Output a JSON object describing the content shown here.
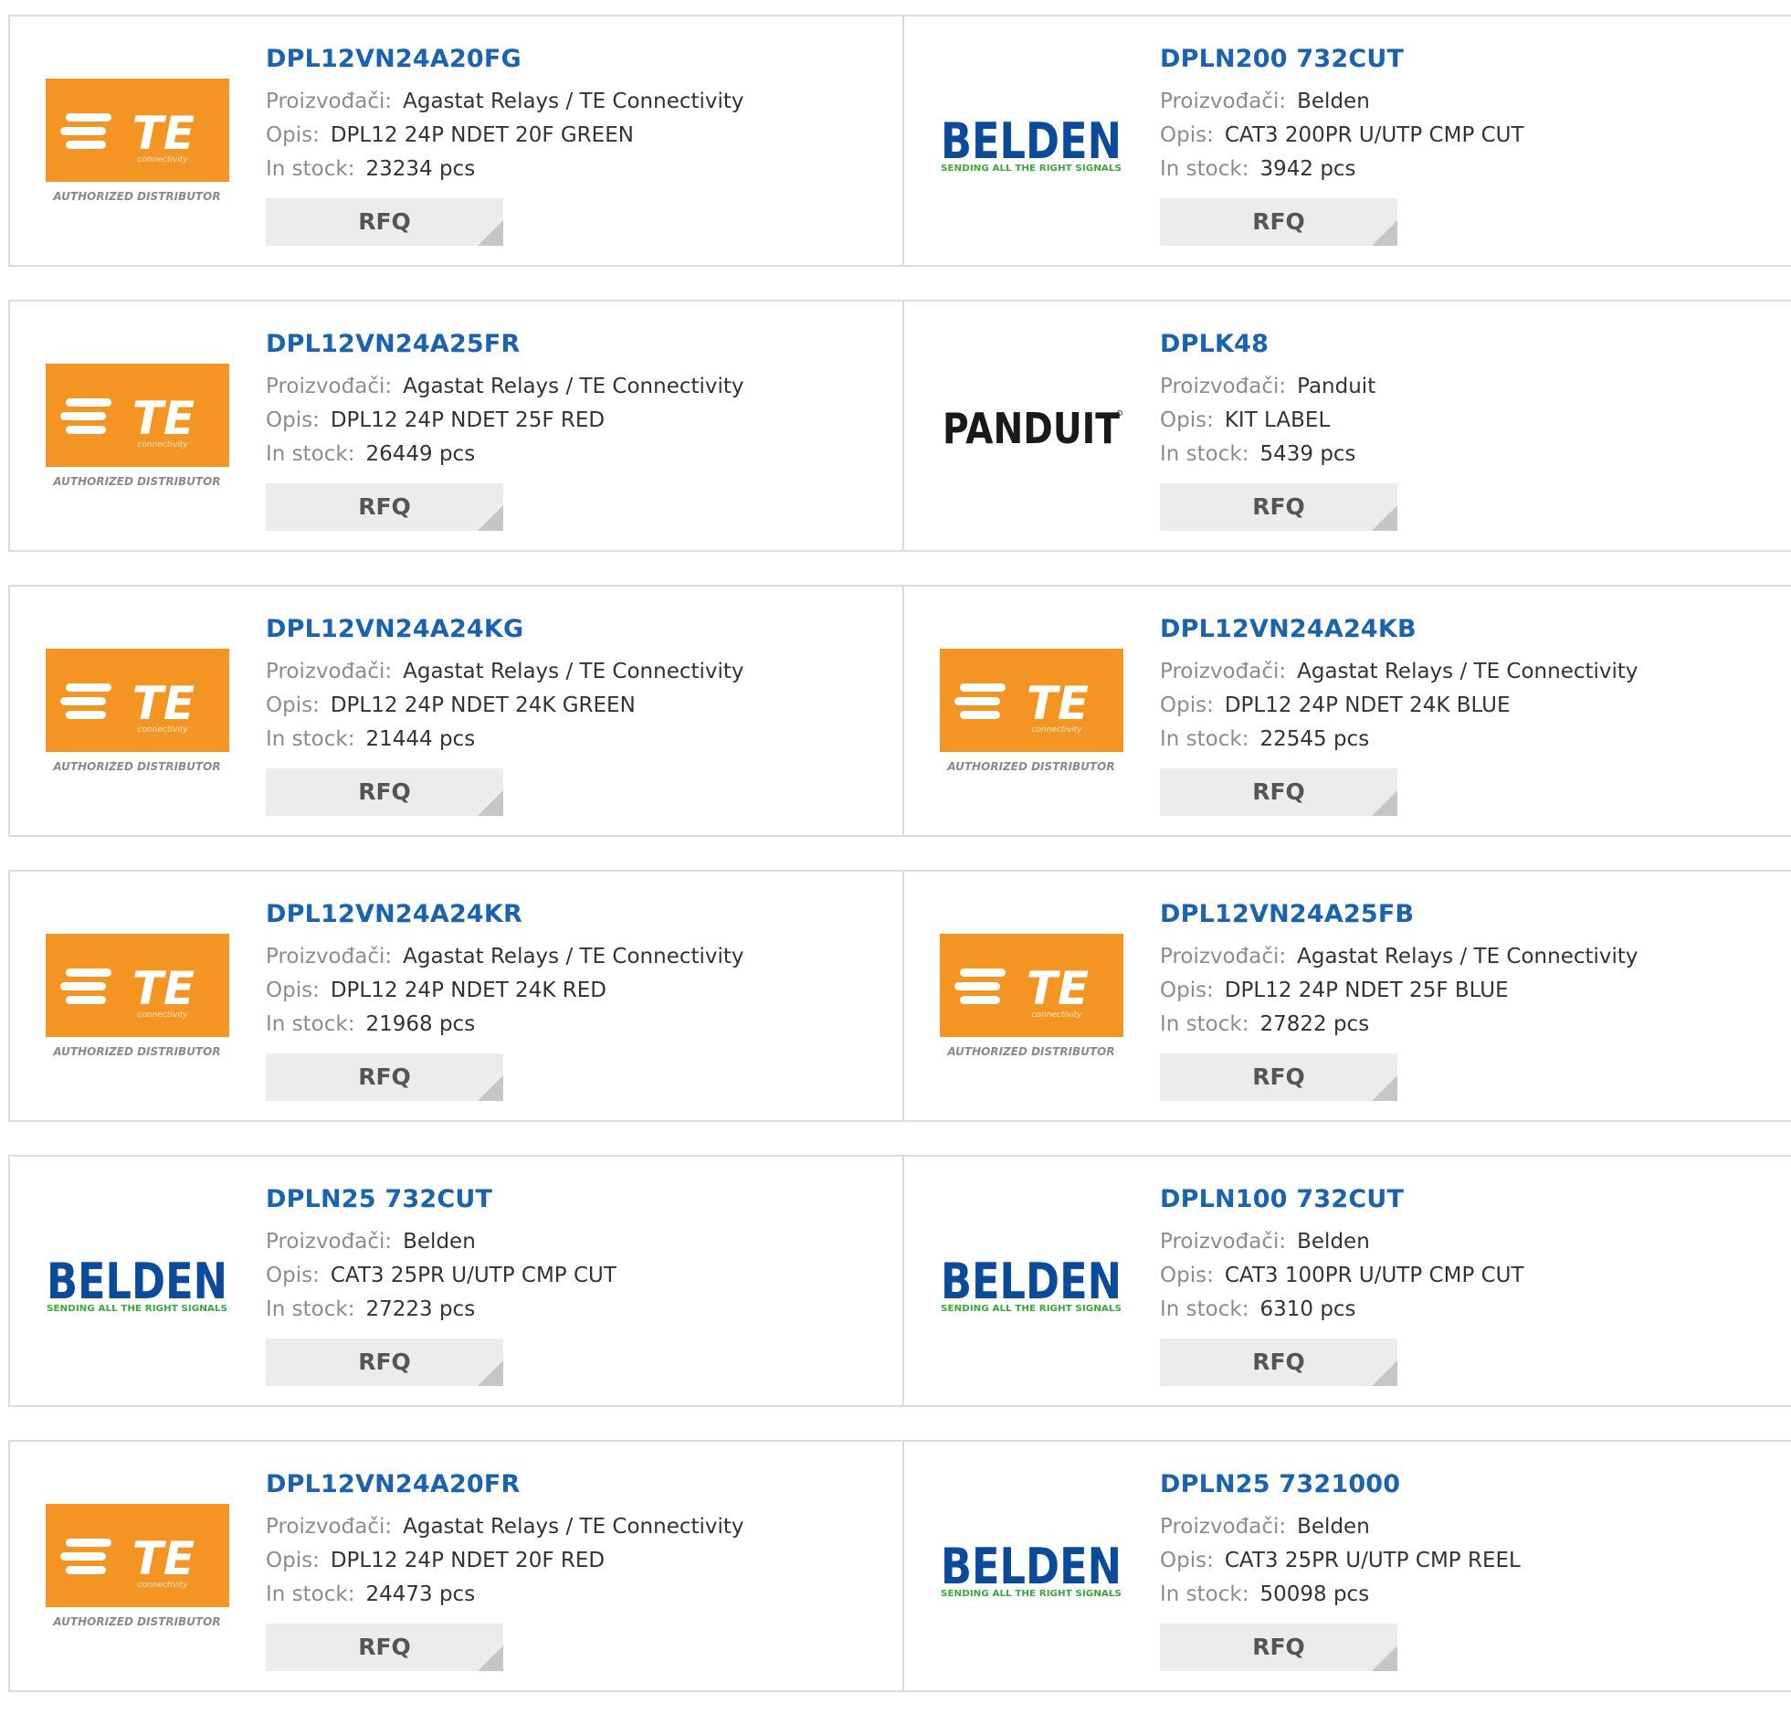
{
  "labels": {
    "manufacturer": "Proizvođači:",
    "description": "Opis:",
    "stock": "In stock:",
    "rfq": "RFQ"
  },
  "brand_colors": {
    "te_orange": "#f39423",
    "belden_blue": "#0a4c9b",
    "belden_green": "#3aa83a",
    "panduit_black": "#1a1a1a",
    "link_blue": "#1a63b0"
  },
  "brands": {
    "te": {
      "mark": "TE",
      "sub": "connectivity",
      "tagline": "AUTHORIZED DISTRIBUTOR"
    },
    "belden": {
      "mark": "BELDEN",
      "tagline": "SENDING ALL THE RIGHT SIGNALS"
    },
    "panduit": {
      "mark": "PANDUIT"
    }
  },
  "products": [
    {
      "part": "DPL12VN24A20FG",
      "brand": "te",
      "manufacturer": "Agastat Relays / TE Connectivity",
      "description": "DPL12 24P NDET 20F GREEN",
      "stock": "23234 pcs"
    },
    {
      "part": "DPLN200 732CUT",
      "brand": "belden",
      "manufacturer": "Belden",
      "description": "CAT3 200PR U/UTP CMP CUT",
      "stock": "3942 pcs"
    },
    {
      "part": "DPL12VN24A25FR",
      "brand": "te",
      "manufacturer": "Agastat Relays / TE Connectivity",
      "description": "DPL12 24P NDET 25F RED",
      "stock": "26449 pcs"
    },
    {
      "part": "DPLK48",
      "brand": "panduit",
      "manufacturer": "Panduit",
      "description": "KIT LABEL",
      "stock": "5439 pcs"
    },
    {
      "part": "DPL12VN24A24KG",
      "brand": "te",
      "manufacturer": "Agastat Relays / TE Connectivity",
      "description": "DPL12 24P NDET 24K GREEN",
      "stock": "21444 pcs"
    },
    {
      "part": "DPL12VN24A24KB",
      "brand": "te",
      "manufacturer": "Agastat Relays / TE Connectivity",
      "description": "DPL12 24P NDET 24K BLUE",
      "stock": "22545 pcs"
    },
    {
      "part": "DPL12VN24A24KR",
      "brand": "te",
      "manufacturer": "Agastat Relays / TE Connectivity",
      "description": "DPL12 24P NDET 24K RED",
      "stock": "21968 pcs"
    },
    {
      "part": "DPL12VN24A25FB",
      "brand": "te",
      "manufacturer": "Agastat Relays / TE Connectivity",
      "description": "DPL12 24P NDET 25F BLUE",
      "stock": "27822 pcs"
    },
    {
      "part": "DPLN25 732CUT",
      "brand": "belden",
      "manufacturer": "Belden",
      "description": "CAT3 25PR U/UTP CMP CUT",
      "stock": "27223 pcs"
    },
    {
      "part": "DPLN100 732CUT",
      "brand": "belden",
      "manufacturer": "Belden",
      "description": "CAT3 100PR U/UTP CMP CUT",
      "stock": "6310 pcs"
    },
    {
      "part": "DPL12VN24A20FR",
      "brand": "te",
      "manufacturer": "Agastat Relays / TE Connectivity",
      "description": "DPL12 24P NDET 20F RED",
      "stock": "24473 pcs"
    },
    {
      "part": "DPLN25 7321000",
      "brand": "belden",
      "manufacturer": "Belden",
      "description": "CAT3 25PR U/UTP CMP REEL",
      "stock": "50098 pcs"
    }
  ]
}
